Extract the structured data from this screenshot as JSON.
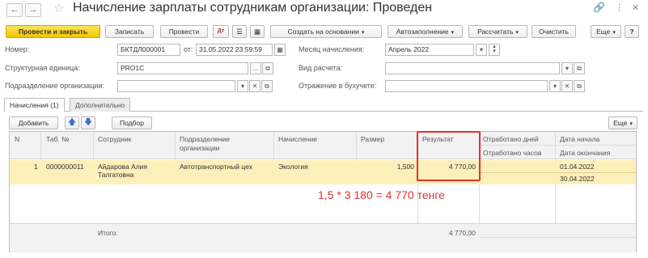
{
  "window": {
    "title": "Начисление зарплаты сотрудникам организации: Проведен",
    "icons": [
      "back-arrow",
      "forward-arrow",
      "star",
      "link",
      "more-vertical",
      "close"
    ]
  },
  "toolbar": {
    "post_close": "Провести и закрыть",
    "save": "Записать",
    "post": "Провести",
    "create_based": "Создать на основании",
    "autofill": "Автозаполнение",
    "calculate": "Рассчитать",
    "clear": "Очистить",
    "more": "Еще",
    "help": "?"
  },
  "form": {
    "number_label": "Номер:",
    "number_value": "БКТДЛ000001",
    "date_label": "от:",
    "date_value": "31.05.2022 23:59:59",
    "month_label": "Месяц начисления:",
    "month_value": "Апрель 2022",
    "unit_label": "Структурная единица:",
    "unit_value": "PRO1C",
    "calc_type_label": "Вид расчета:",
    "calc_type_value": "",
    "dept_label": "Подразделение организации:",
    "dept_value": "",
    "reflection_label": "Отражение в бухучете:",
    "reflection_value": ""
  },
  "tabs": [
    "Начисления (1)",
    "Дополнительно"
  ],
  "table_toolbar": {
    "add": "Добавить",
    "selection": "Подбор",
    "more": "Еще"
  },
  "table": {
    "headers": {
      "n": "N",
      "tab_no": "Таб. №",
      "employee": "Сотрудник",
      "dept_line1": "Подразделение",
      "dept_line2": "организации",
      "accrual": "Начисление",
      "size": "Размер",
      "result": "Результат",
      "days_worked": "Отработано дней",
      "hours_worked": "Отработано часов",
      "date_start": "Дата начала",
      "date_end": "Дата окончания"
    },
    "row": {
      "n": "1",
      "tab_no": "0000000011",
      "employee_line1": "Айдарова Алия",
      "employee_line2": "Талгатовна",
      "dept": "Автотранспортный цех",
      "accrual": "Экология",
      "size": "1,500",
      "result": "4 770,00",
      "days_worked": "",
      "hours_worked": "",
      "date_start": "01.04.2022",
      "date_end": "30.04.2022"
    },
    "footer": {
      "total_label": "Итого:",
      "total_value": "4 770,00"
    }
  },
  "annotation": "1,5 * 3 180  = 4 770 тенге",
  "colors": {
    "primary_button": "#f5cd15",
    "selected_row": "#fcefba",
    "highlight": "#e53030"
  }
}
